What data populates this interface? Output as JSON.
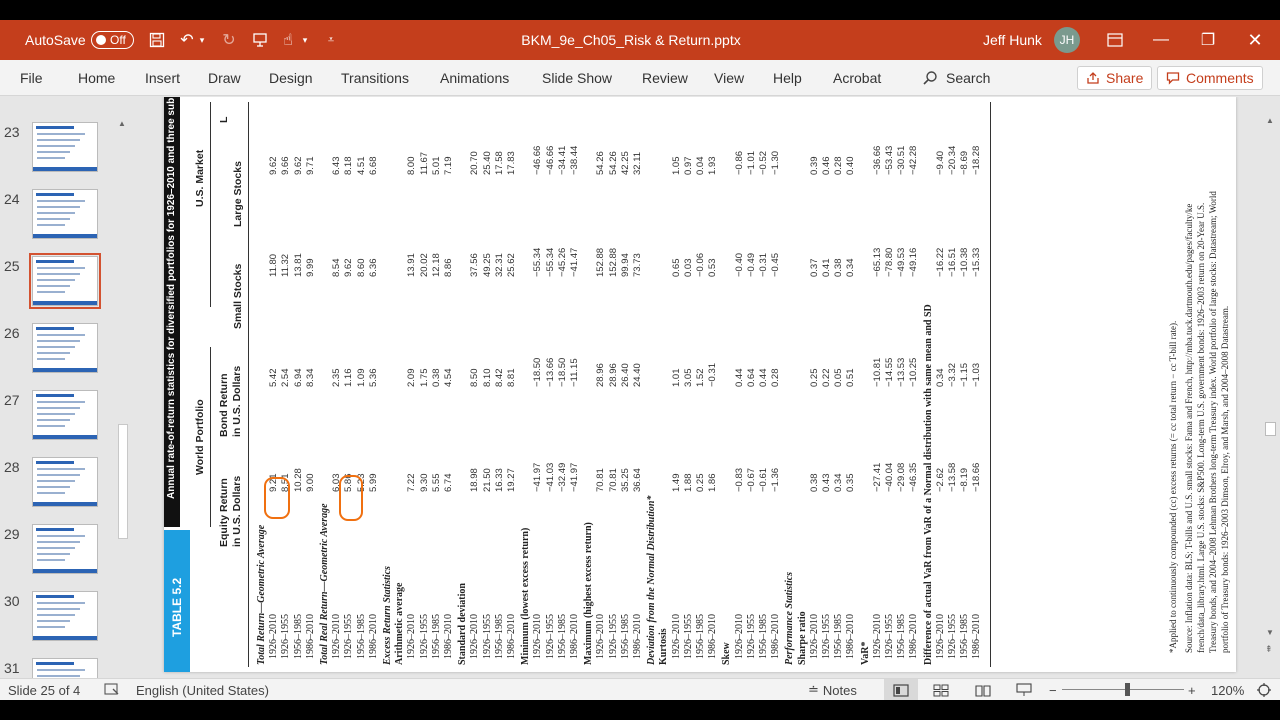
{
  "titlebar": {
    "autosave_label": "AutoSave",
    "autosave_state": "Off",
    "doc_title": "BKM_9e_Ch05_Risk & Return.pptx",
    "user_name": "Jeff Hunk",
    "user_initials": "JH"
  },
  "ribbon": {
    "tabs": [
      "File",
      "Home",
      "Insert",
      "Draw",
      "Design",
      "Transitions",
      "Animations",
      "Slide Show",
      "Review",
      "View",
      "Help",
      "Acrobat"
    ],
    "search_label": "Search",
    "share_label": "Share",
    "comments_label": "Comments"
  },
  "thumbnails": {
    "numbers": [
      "23",
      "24",
      "25",
      "26",
      "27",
      "28",
      "29",
      "30",
      "31"
    ],
    "selected": "25"
  },
  "slide": {
    "table_tag": "TABLE 5.2",
    "table_title": "Annual rate-of-return statistics for diversified portfolios for 1926–2010 and three sub",
    "group_world": "World Portfolio",
    "group_us": "U.S. Market",
    "col_equity": [
      "Equity Return",
      "in U.S. Dollars"
    ],
    "col_bond": [
      "Bond Return",
      "in U.S. Dollars"
    ],
    "col_small": "Small Stocks",
    "col_large": "Large Stocks",
    "col_extra": "L",
    "periods": [
      "1926–2010",
      "1926–1955",
      "1956–1985",
      "1986–2010"
    ],
    "sections": [
      {
        "label": "Total Return—Geometric Average",
        "bold": true,
        "italic": true,
        "cols": [
          [
            "9.21",
            "8.51",
            "10.28",
            "9.00"
          ],
          [
            "5.42",
            "2.54",
            "6.94",
            "8.34"
          ],
          [
            "11.80",
            "11.32",
            "13.81",
            "9.99"
          ],
          [
            "9.62",
            "9.66",
            "9.62",
            "9.71"
          ]
        ]
      },
      {
        "label": "Total Real Return—Geometric Average",
        "bold": true,
        "italic": true,
        "cols": [
          [
            "6.03",
            "5.86",
            "5.23",
            "5.99"
          ],
          [
            "2.35",
            "1.16",
            "1.09",
            "5.36"
          ],
          [
            "8.54",
            "9.62",
            "8.60",
            "6.36"
          ],
          [
            "6.43",
            "8.18",
            "4.51",
            "6.68"
          ]
        ]
      },
      {
        "label": "Excess Return Statistics",
        "bold": true,
        "italic": true,
        "header_only": true
      },
      {
        "label": "Arithmetic average",
        "bold": true,
        "cols": [
          [
            "7.22",
            "9.30",
            "5.55",
            "6.74"
          ],
          [
            "2.09",
            "1.75",
            "0.38",
            "4.54"
          ],
          [
            "13.91",
            "20.02",
            "12.18",
            "8.86"
          ],
          [
            "8.00",
            "11.67",
            "5.01",
            "7.19"
          ]
        ]
      },
      {
        "label": "Standard deviation",
        "bold": true,
        "cols": [
          [
            "18.98",
            "21.50",
            "16.33",
            "19.27"
          ],
          [
            "8.50",
            "8.10",
            "8.42",
            "8.81"
          ],
          [
            "37.56",
            "49.25",
            "32.31",
            "25.62"
          ],
          [
            "20.70",
            "25.40",
            "17.58",
            "17.83"
          ]
        ]
      },
      {
        "label": "Minimum (lowest excess return)",
        "bold": true,
        "cols": [
          [
            "−41.97",
            "−41.03",
            "−32.49",
            "−41.97"
          ],
          [
            "−18.50",
            "−13.66",
            "−18.50",
            "−11.15"
          ],
          [
            "−55.34",
            "−55.34",
            "−45.26",
            "−41.47"
          ],
          [
            "−46.66",
            "−46.66",
            "−34.41",
            "−38.44"
          ]
        ]
      },
      {
        "label": "Maximum (highest excess return)",
        "bold": true,
        "cols": [
          [
            "70.81",
            "70.81",
            "35.25",
            "36.64"
          ],
          [
            "28.96",
            "28.96",
            "26.40",
            "24.40"
          ],
          [
            "152.88",
            "152.88",
            "99.94",
            "73.73"
          ],
          [
            "54.26",
            "54.26",
            "42.25",
            "32.11"
          ]
        ]
      },
      {
        "label": "Deviation from the Normal Distribution*",
        "bold": true,
        "italic": true,
        "header_only": true
      },
      {
        "label": "Kurtosis",
        "bold": true,
        "cols": [
          [
            "1.49",
            "1.88",
            "0.25",
            "1.86"
          ],
          [
            "1.01",
            "3.05",
            "1.52",
            "−0.31"
          ],
          [
            "0.65",
            "0.03",
            "−0.06",
            "0.53"
          ],
          [
            "1.05",
            "0.97",
            "0.04",
            "1.93"
          ]
        ]
      },
      {
        "label": "Skew",
        "bold": true,
        "cols": [
          [
            "−0.83",
            "−0.67",
            "−0.61",
            "−1.36"
          ],
          [
            "0.44",
            "0.64",
            "0.44",
            "0.28"
          ],
          [
            "−0.40",
            "−0.49",
            "−0.31",
            "−0.45"
          ],
          [
            "−0.86",
            "−1.01",
            "−0.52",
            "−1.30"
          ]
        ]
      },
      {
        "label": "Performance Statistics",
        "bold": true,
        "italic": true,
        "header_only": true
      },
      {
        "label": "Sharpe ratio",
        "bold": true,
        "cols": [
          [
            "0.38",
            "0.43",
            "0.34",
            "0.35"
          ],
          [
            "0.25",
            "0.22",
            "0.05",
            "0.51"
          ],
          [
            "0.37",
            "0.41",
            "0.38",
            "0.34"
          ],
          [
            "0.39",
            "0.46",
            "0.28",
            "0.40"
          ]
        ]
      },
      {
        "label": "VaR*",
        "bold": true,
        "cols": [
          [
            "−27.41",
            "−40.04",
            "−29.08",
            "−46.35"
          ],
          [
            "−10.81",
            "−14.55",
            "−13.53",
            "−10.25"
          ],
          [
            "−65.13",
            "−78.80",
            "−49.53",
            "−49.16"
          ],
          [
            "−36.66",
            "−53.43",
            "−30.51",
            "−42.28"
          ]
        ]
      },
      {
        "label": "Difference of actual VaR from VaR of a Normal distribution with same mean and SD",
        "bold": true,
        "cols": [
          [
            "−2.62",
            "−13.58",
            "−8.19",
            "−18.66"
          ],
          [
            "0.34",
            "−3.32",
            "−1.15",
            "−1.03"
          ],
          [
            "−16.22",
            "−16.51",
            "−10.38",
            "−15.33"
          ],
          [
            "−9.40",
            "−20.34",
            "−8.69",
            "−18.28"
          ]
        ]
      }
    ],
    "footnotes": [
      "*Applied to continuously compounded (cc) excess returns (= cc total return − cc T-bill rate).",
      "Source: Inflation data: BLS; T-bills and U.S. small stocks: Fama and French, http://mba.tuck.dartmouth.edu/pages/faculty/ke",
      "french/data_library.html. Large U.S. stocks: S&P500. Long-term U.S. government bonds: 1926–2003 return on 20-Year U.S.",
      "Treasury bonds, and 2004–2008 Lehman Brothers long-term Treasury index. World portfolio of large stocks: Datastream; World",
      "portfolio of Treasury bonds: 1926–2003 Dimson, Elroy, and Marsh, and 2004–2008 Datastream."
    ]
  },
  "status": {
    "slide_info": "Slide 25 of 4",
    "language": "English (United States)",
    "notes_label": "Notes",
    "zoom": "120%"
  }
}
